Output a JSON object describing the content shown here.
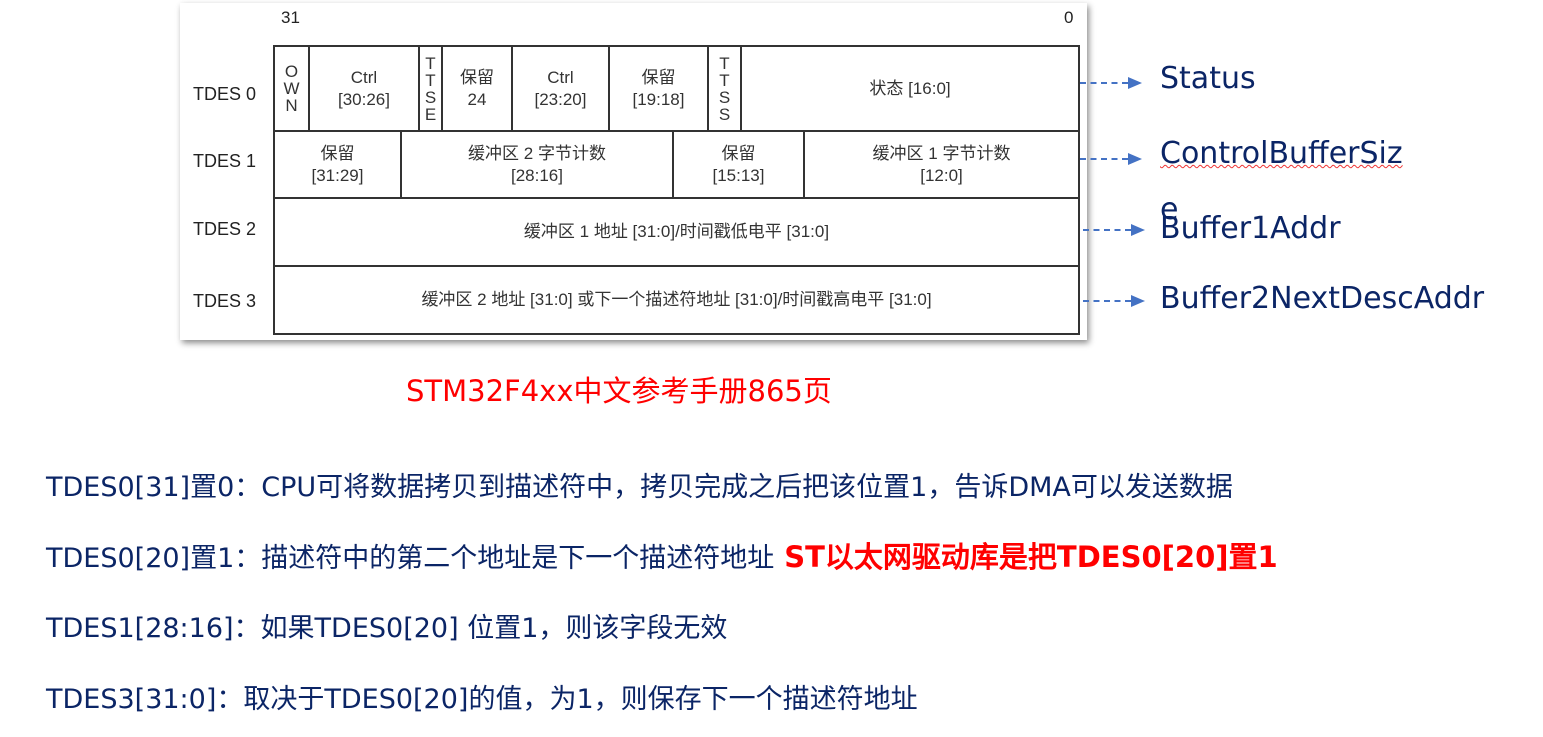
{
  "figure": {
    "bit_high": "31",
    "bit_low": "0",
    "rows": [
      "TDES 0",
      "TDES 1",
      "TDES 2",
      "TDES 3"
    ],
    "tdes0": [
      "O\nW\nN",
      "Ctrl\n[30:26]",
      "T\nT\nS\nE",
      "保留\n24",
      "Ctrl\n[23:20]",
      "保留\n[19:18]",
      "T\nT\nS\nS",
      "状态 [16:0]"
    ],
    "tdes1": [
      "保留\n[31:29]",
      "缓冲区 2 字节计数\n[28:16]",
      "保留\n[15:13]",
      "缓冲区 1 字节计数\n[12:0]"
    ],
    "tdes2": "缓冲区 1 地址 [31:0]/时间戳低电平 [31:0]",
    "tdes3": "缓冲区 2 地址 [31:0] 或下一个描述符地址 [31:0]/时间戳高电平 [31:0]"
  },
  "side_labels": [
    "Status",
    "ControlBufferSiz",
    "e",
    "Buffer1Addr",
    "Buffer2NextDescAddr"
  ],
  "caption": "STM32F4xx中文参考手册865页",
  "notes": [
    {
      "text": "TDES0[31]置0：CPU可将数据拷贝到描述符中，拷贝完成之后把该位置1，告诉DMA可以发送数据"
    },
    {
      "text": "TDES0[20]置1：描述符中的第二个地址是下一个描述符地址",
      "highlight": "ST以太网驱动库是把TDES0[20]置1"
    },
    {
      "text": "TDES1[28:16]：如果TDES0[20] 位置1，则该字段无效"
    },
    {
      "text": "TDES3[31:0]：取决于TDES0[20]的值，为1，则保存下一个描述符地址"
    }
  ],
  "colors": {
    "text": "#0b2566",
    "arrow": "#4472c4",
    "highlight": "#ff0000"
  }
}
